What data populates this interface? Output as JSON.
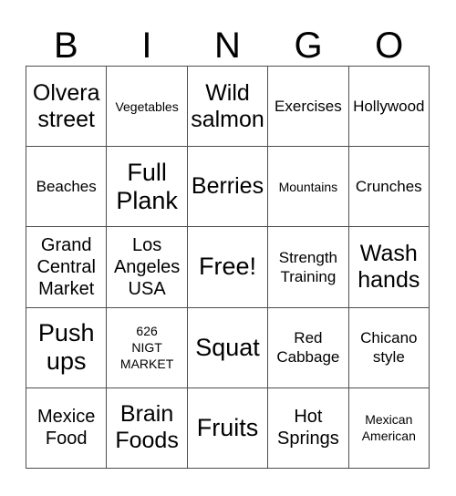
{
  "card": {
    "title": "BINGO",
    "header_letters": [
      "B",
      "I",
      "N",
      "G",
      "O"
    ],
    "border_color": "#4d4d4d",
    "background_color": "#ffffff",
    "text_color": "#000000",
    "columns": 5,
    "rows": 5,
    "free_space_label": "Free!",
    "free_space_position": "center"
  },
  "cells": [
    {
      "text": "Olvera\nstreet",
      "size": "lg"
    },
    {
      "text": "Vegetables",
      "size": "xs"
    },
    {
      "text": "Wild\nsalmon",
      "size": "lg"
    },
    {
      "text": "Exercises",
      "size": "sm"
    },
    {
      "text": "Hollywood",
      "size": "sm"
    },
    {
      "text": "Beaches",
      "size": "sm"
    },
    {
      "text": "Full\nPlank",
      "size": "xl"
    },
    {
      "text": "Berries",
      "size": "lg"
    },
    {
      "text": "Mountains",
      "size": "xs"
    },
    {
      "text": "Crunches",
      "size": "sm"
    },
    {
      "text": "Grand\nCentral\nMarket",
      "size": "md"
    },
    {
      "text": "Los\nAngeles\nUSA",
      "size": "md"
    },
    {
      "text": "Free!",
      "size": "xl"
    },
    {
      "text": "Strength\nTraining",
      "size": "sm"
    },
    {
      "text": "Wash\nhands",
      "size": "lg"
    },
    {
      "text": "Push\nups",
      "size": "xl"
    },
    {
      "text": "626\nNIGT\nMARKET",
      "size": "xs"
    },
    {
      "text": "Squat",
      "size": "xl"
    },
    {
      "text": "Red\nCabbage",
      "size": "sm"
    },
    {
      "text": "Chicano\nstyle",
      "size": "sm"
    },
    {
      "text": "Mexice\nFood",
      "size": "md"
    },
    {
      "text": "Brain\nFoods",
      "size": "lg"
    },
    {
      "text": "Fruits",
      "size": "xl"
    },
    {
      "text": "Hot\nSprings",
      "size": "md"
    },
    {
      "text": "Mexican\nAmerican",
      "size": "xs"
    }
  ]
}
